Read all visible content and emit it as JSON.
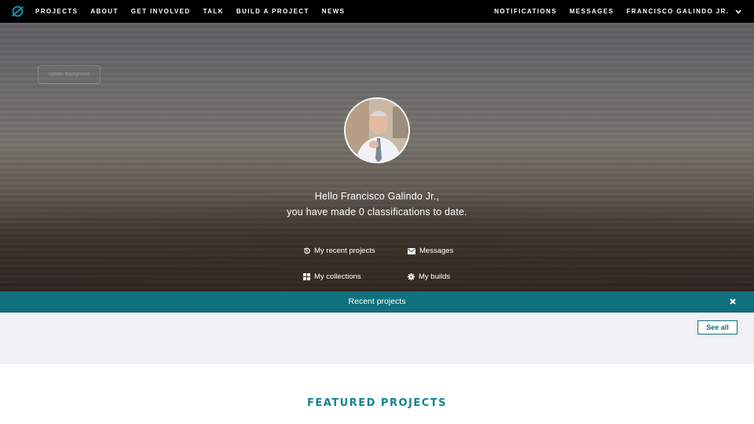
{
  "nav": {
    "items": [
      {
        "label": "PROJECTS"
      },
      {
        "label": "ABOUT"
      },
      {
        "label": "GET INVOLVED"
      },
      {
        "label": "TALK"
      },
      {
        "label": "BUILD A PROJECT"
      },
      {
        "label": "NEWS"
      }
    ],
    "right": {
      "notifications": "NOTIFICATIONS",
      "messages": "MESSAGES",
      "user": "FRANCISCO GALINDO JR."
    }
  },
  "hero": {
    "update_background": "Update Background",
    "greeting_line1": "Hello Francisco Galindo Jr.,",
    "greeting_line2": "you have made 0 classifications to date.",
    "links": {
      "recent_projects": "My recent projects",
      "messages": "Messages",
      "collections": "My collections",
      "builds": "My builds"
    }
  },
  "recent": {
    "title": "Recent projects",
    "see_all": "See all"
  },
  "featured": {
    "title": "FEATURED PROJECTS"
  },
  "colors": {
    "accent": "#10707e",
    "nav_bg": "#000000",
    "featured_text": "#10838f"
  }
}
